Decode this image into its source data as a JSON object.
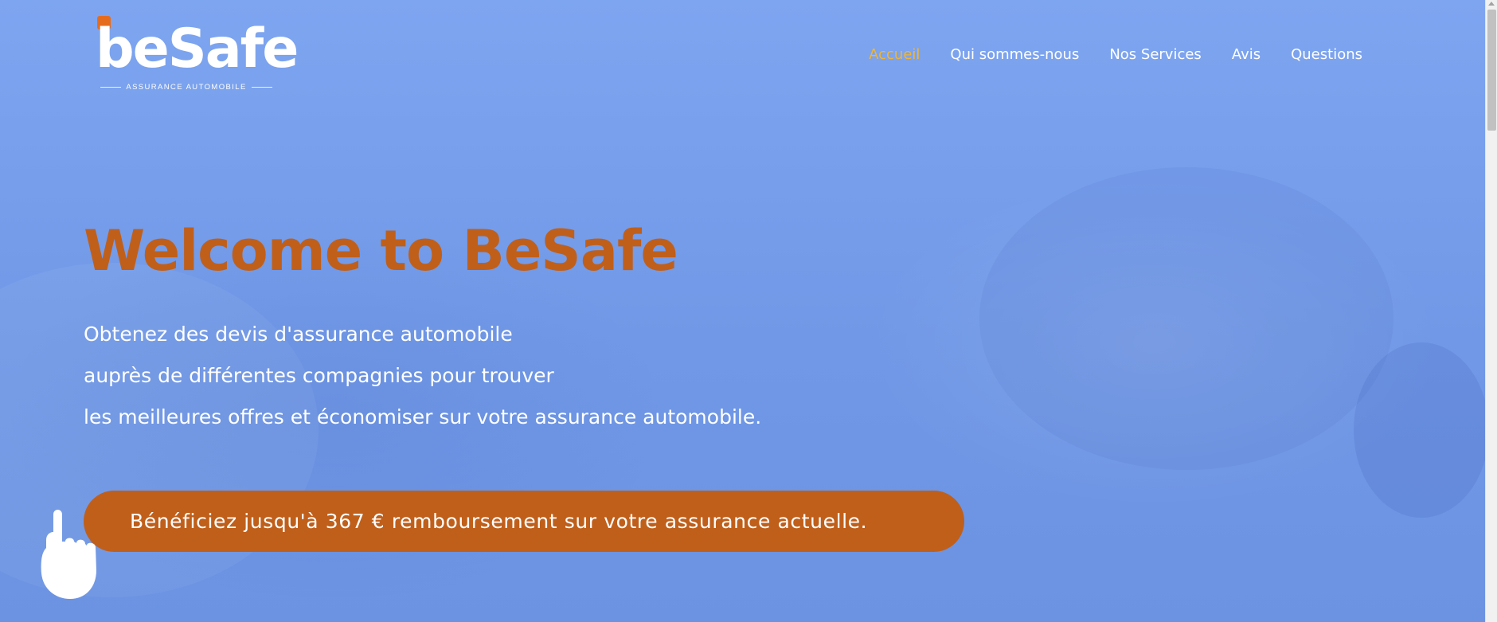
{
  "colors": {
    "accent": "#c05f1a",
    "nav_active": "#f2b531",
    "text_light": "#ffffff",
    "logo_dot": "#e66c1d"
  },
  "logo": {
    "wordmark": "beSafe",
    "tagline": "ASSURANCE AUTOMOBILE"
  },
  "nav": {
    "items": [
      {
        "label": "Accueil",
        "active": true
      },
      {
        "label": "Qui sommes-nous",
        "active": false
      },
      {
        "label": "Nos Services",
        "active": false
      },
      {
        "label": "Avis",
        "active": false
      },
      {
        "label": "Questions",
        "active": false
      }
    ]
  },
  "hero": {
    "title": "Welcome to BeSafe",
    "lines": [
      "Obtenez des devis d'assurance automobile",
      "auprès de différentes compagnies pour trouver",
      "les meilleures offres et économiser sur votre assurance automobile."
    ],
    "cta_label": "Bénéficiez jusqu'à 367 € remboursement sur votre assurance actuelle."
  },
  "icons": {
    "cursor": "hand-pointer-icon"
  }
}
